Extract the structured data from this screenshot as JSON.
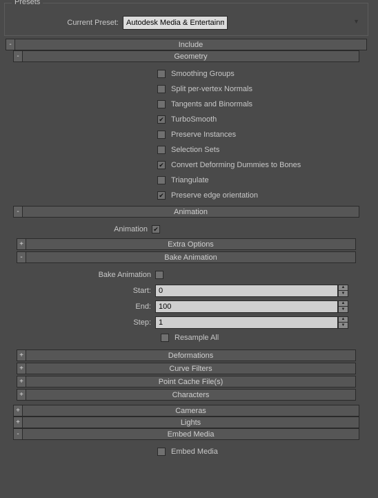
{
  "presets": {
    "fieldset_label": "Presets",
    "current_label": "Current Preset:",
    "selected": "Autodesk Media & Entertainment"
  },
  "include": {
    "title": "Include",
    "geometry": {
      "title": "Geometry",
      "options": [
        {
          "label": "Smoothing Groups",
          "checked": false
        },
        {
          "label": "Split per-vertex Normals",
          "checked": false
        },
        {
          "label": "Tangents and Binormals",
          "checked": false
        },
        {
          "label": "TurboSmooth",
          "checked": true
        },
        {
          "label": "Preserve Instances",
          "checked": false
        },
        {
          "label": "Selection Sets",
          "checked": false
        },
        {
          "label": "Convert Deforming Dummies to Bones",
          "checked": true
        },
        {
          "label": "Triangulate",
          "checked": false
        },
        {
          "label": "Preserve edge orientation",
          "checked": true
        }
      ]
    },
    "animation": {
      "title": "Animation",
      "enable_label": "Animation",
      "enable_checked": true,
      "extra_options": {
        "title": "Extra Options"
      },
      "bake": {
        "title": "Bake Animation",
        "enable_label": "Bake Animation",
        "enable_checked": false,
        "start_label": "Start:",
        "start_value": "0",
        "end_label": "End:",
        "end_value": "100",
        "step_label": "Step:",
        "step_value": "1",
        "resample_label": "Resample All",
        "resample_checked": false
      },
      "deformations": {
        "title": "Deformations"
      },
      "curve_filters": {
        "title": "Curve Filters"
      },
      "point_cache": {
        "title": "Point Cache File(s)"
      },
      "characters": {
        "title": "Characters"
      }
    },
    "cameras": {
      "title": "Cameras"
    },
    "lights": {
      "title": "Lights"
    },
    "embed_media": {
      "title": "Embed Media",
      "option_label": "Embed Media",
      "option_checked": false
    }
  },
  "chart_data": null
}
